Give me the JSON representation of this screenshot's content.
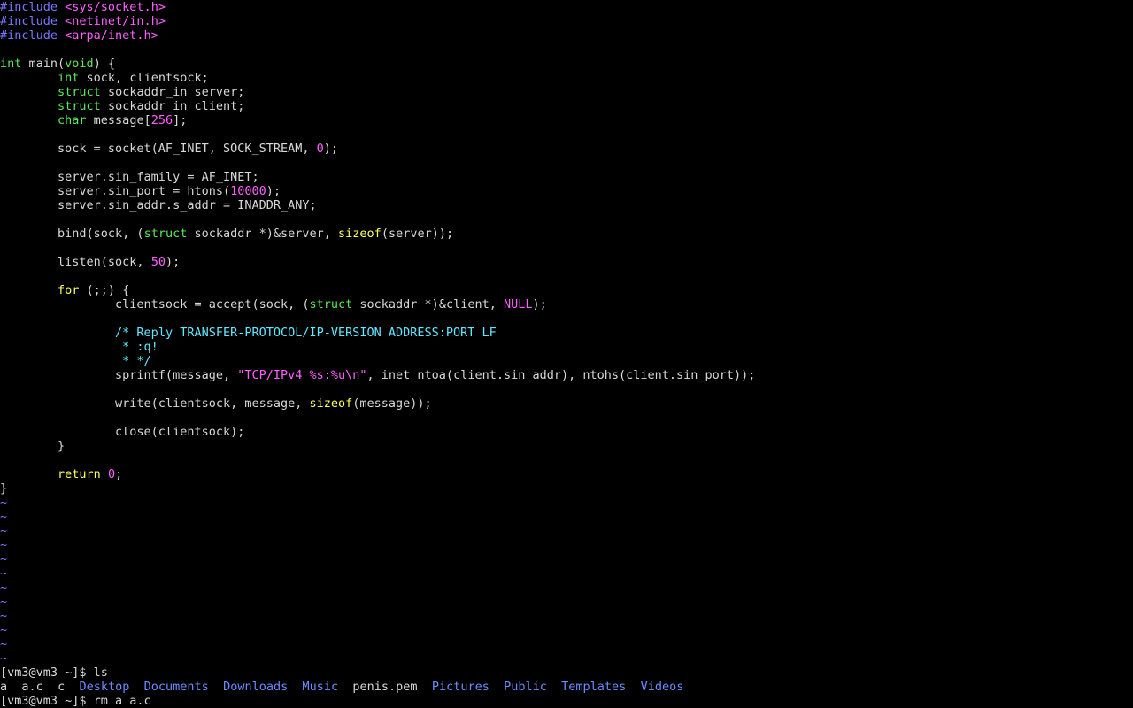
{
  "terminal": {
    "colors": {
      "background": "#000000",
      "text": "#d8d8d8",
      "preprocessor": "#7878ff",
      "include_path": "#ff60ff",
      "type": "#58e858",
      "number": "#ff60ff",
      "keyword": "#ffff60",
      "comment": "#60e8ff",
      "tilde": "#7878ff",
      "directory": "#6a8cff"
    },
    "code_lines": [
      [
        [
          "pre",
          "#include "
        ],
        [
          "inc",
          "<sys/socket.h>"
        ]
      ],
      [
        [
          "pre",
          "#include "
        ],
        [
          "inc",
          "<netinet/in.h>"
        ]
      ],
      [
        [
          "pre",
          "#include "
        ],
        [
          "inc",
          "<arpa/inet.h>"
        ]
      ],
      [],
      [
        [
          "type",
          "int"
        ],
        [
          "txt",
          " main("
        ],
        [
          "type",
          "void"
        ],
        [
          "txt",
          ") {"
        ]
      ],
      [
        [
          "txt",
          "        "
        ],
        [
          "type",
          "int"
        ],
        [
          "txt",
          " sock, clientsock;"
        ]
      ],
      [
        [
          "txt",
          "        "
        ],
        [
          "type",
          "struct"
        ],
        [
          "txt",
          " sockaddr_in server;"
        ]
      ],
      [
        [
          "txt",
          "        "
        ],
        [
          "type",
          "struct"
        ],
        [
          "txt",
          " sockaddr_in client;"
        ]
      ],
      [
        [
          "txt",
          "        "
        ],
        [
          "type",
          "char"
        ],
        [
          "txt",
          " message["
        ],
        [
          "num",
          "256"
        ],
        [
          "txt",
          "];"
        ]
      ],
      [],
      [
        [
          "txt",
          "        sock = socket(AF_INET, SOCK_STREAM, "
        ],
        [
          "num",
          "0"
        ],
        [
          "txt",
          ");"
        ]
      ],
      [],
      [
        [
          "txt",
          "        server.sin_family = AF_INET;"
        ]
      ],
      [
        [
          "txt",
          "        server.sin_port = htons("
        ],
        [
          "num",
          "10000"
        ],
        [
          "txt",
          ");"
        ]
      ],
      [
        [
          "txt",
          "        server.sin_addr.s_addr = INADDR_ANY;"
        ]
      ],
      [],
      [
        [
          "txt",
          "        bind(sock, ("
        ],
        [
          "type",
          "struct"
        ],
        [
          "txt",
          " sockaddr *)&server, "
        ],
        [
          "kw",
          "sizeof"
        ],
        [
          "txt",
          "(server));"
        ]
      ],
      [],
      [
        [
          "txt",
          "        listen(sock, "
        ],
        [
          "num",
          "50"
        ],
        [
          "txt",
          ");"
        ]
      ],
      [],
      [
        [
          "txt",
          "        "
        ],
        [
          "kw",
          "for"
        ],
        [
          "txt",
          " (;;) {"
        ]
      ],
      [
        [
          "txt",
          "                clientsock = accept(sock, ("
        ],
        [
          "type",
          "struct"
        ],
        [
          "txt",
          " sockaddr *)&client, "
        ],
        [
          "num",
          "NULL"
        ],
        [
          "txt",
          ");"
        ]
      ],
      [],
      [
        [
          "txt",
          "                "
        ],
        [
          "cmt",
          "/* Reply TRANSFER-PROTOCOL/IP-VERSION ADDRESS:PORT LF"
        ]
      ],
      [
        [
          "txt",
          "                "
        ],
        [
          "cmt",
          " * :q!"
        ]
      ],
      [
        [
          "txt",
          "                "
        ],
        [
          "cmt",
          " * */"
        ]
      ],
      [
        [
          "txt",
          "                sprintf(message, "
        ],
        [
          "str",
          "\"TCP/IPv4 %s:%u\\n\""
        ],
        [
          "txt",
          ", inet_ntoa(client.sin_addr), ntohs(client.sin_port));"
        ]
      ],
      [],
      [
        [
          "txt",
          "                write(clientsock, message, "
        ],
        [
          "kw",
          "sizeof"
        ],
        [
          "txt",
          "(message));"
        ]
      ],
      [],
      [
        [
          "txt",
          "                close(clientsock);"
        ]
      ],
      [
        [
          "txt",
          "        }"
        ]
      ],
      [],
      [
        [
          "txt",
          "        "
        ],
        [
          "kw",
          "return"
        ],
        [
          "txt",
          " "
        ],
        [
          "num",
          "0"
        ],
        [
          "txt",
          ";"
        ]
      ],
      [
        [
          "txt",
          "}"
        ]
      ]
    ],
    "tilde_lines": [
      "~",
      "~",
      "~",
      "~",
      "~",
      "~",
      "~",
      "~",
      "~",
      "~",
      "~",
      "~"
    ],
    "prompt_ls": "[vm3@vm3 ~]$ ls",
    "ls_entries": [
      {
        "name": "a",
        "kind": "file"
      },
      {
        "name": "a.c",
        "kind": "file"
      },
      {
        "name": "c",
        "kind": "file"
      },
      {
        "name": "Desktop",
        "kind": "dir"
      },
      {
        "name": "Documents",
        "kind": "dir"
      },
      {
        "name": "Downloads",
        "kind": "dir"
      },
      {
        "name": "Music",
        "kind": "dir"
      },
      {
        "name": "penis.pem",
        "kind": "file"
      },
      {
        "name": "Pictures",
        "kind": "dir"
      },
      {
        "name": "Public",
        "kind": "dir"
      },
      {
        "name": "Templates",
        "kind": "dir"
      },
      {
        "name": "Videos",
        "kind": "dir"
      }
    ],
    "prompt_rm": "[vm3@vm3 ~]$ rm a a.c"
  }
}
